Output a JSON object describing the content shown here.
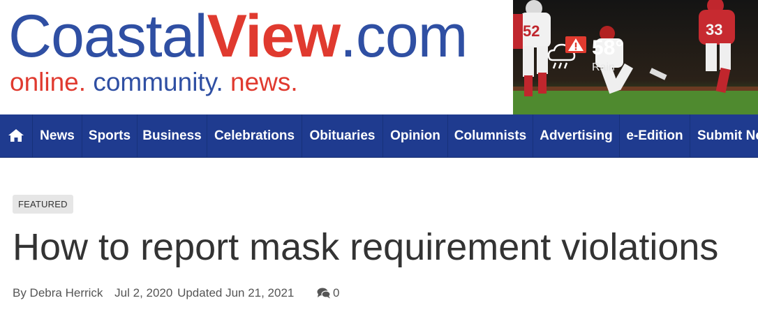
{
  "logo": {
    "name_part1": "Coastal",
    "name_part2": "View",
    "name_part3": ".com",
    "tagline_part1": "online.",
    "tagline_part2": "community.",
    "tagline_part3": "news."
  },
  "weather": {
    "temperature": "58°",
    "condition": "Rain",
    "alert_icon": "warning-triangle-icon",
    "condition_icon": "rain-cloud-icon"
  },
  "nav": {
    "home_icon": "home-icon",
    "items": [
      {
        "label": "News"
      },
      {
        "label": "Sports"
      },
      {
        "label": "Business"
      },
      {
        "label": "Celebrations"
      },
      {
        "label": "Obituaries"
      },
      {
        "label": "Opinion"
      },
      {
        "label": "Columnists"
      },
      {
        "label": "Advertising"
      },
      {
        "label": "e-Edition"
      },
      {
        "label": "Submit News"
      }
    ]
  },
  "article": {
    "flag": "FEATURED",
    "headline": "How to report mask requirement violations",
    "byline": "By Debra Herrick",
    "published": "Jul 2, 2020",
    "updated": "Updated Jun 21, 2021",
    "comment_count": "0",
    "comment_icon": "comments-icon"
  },
  "colors": {
    "brand_blue": "#2f4fa3",
    "brand_red": "#e03a2f",
    "nav_bg": "#1f3b8f"
  }
}
